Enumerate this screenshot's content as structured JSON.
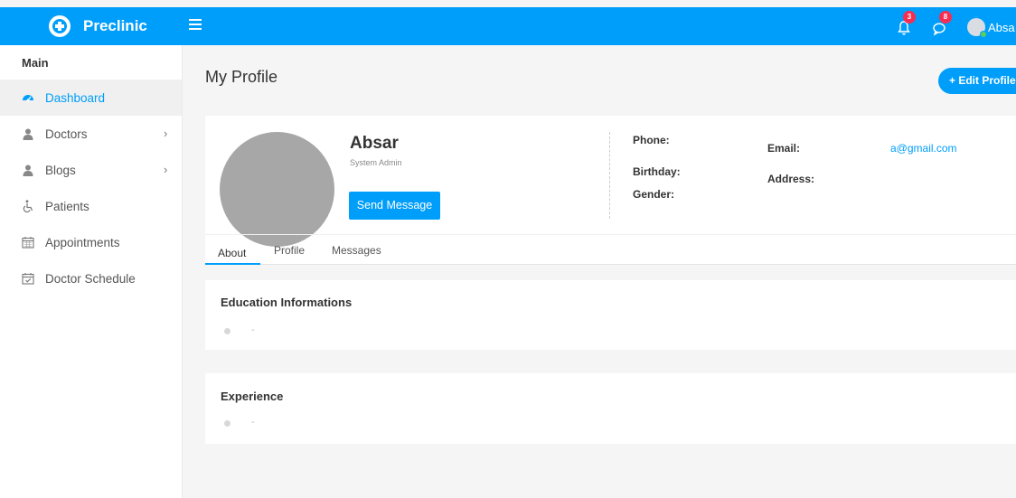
{
  "header": {
    "brand": "Preclinic",
    "notifications_count": "3",
    "messages_count": "8",
    "user_name": "Absa"
  },
  "sidebar": {
    "section_title": "Main",
    "items": [
      {
        "label": "Dashboard",
        "icon": "dashboard-icon"
      },
      {
        "label": "Doctors",
        "icon": "user-icon"
      },
      {
        "label": "Blogs",
        "icon": "user-icon"
      },
      {
        "label": "Patients",
        "icon": "wheelchair-icon"
      },
      {
        "label": "Appointments",
        "icon": "calendar-icon"
      },
      {
        "label": "Doctor Schedule",
        "icon": "calendar-check-icon"
      }
    ],
    "active_color": "#009efb"
  },
  "page": {
    "title": "My Profile",
    "edit_button": "+ Edit Profile"
  },
  "profile": {
    "name": "Absar",
    "role": "System Admin",
    "send_message": "Send Message",
    "phone_label": "Phone:",
    "birthday_label": "Birthday:",
    "gender_label": "Gender:",
    "email_label": "Email:",
    "email_value": "a@gmail.com",
    "address_label": "Address:"
  },
  "tabs": [
    "About",
    "Profile",
    "Messages"
  ],
  "education": {
    "title": "Education Informations",
    "item": "-"
  },
  "experience": {
    "title": "Experience",
    "item": "-"
  },
  "colors": {
    "primary": "#009efb",
    "badge": "#f62d51"
  }
}
